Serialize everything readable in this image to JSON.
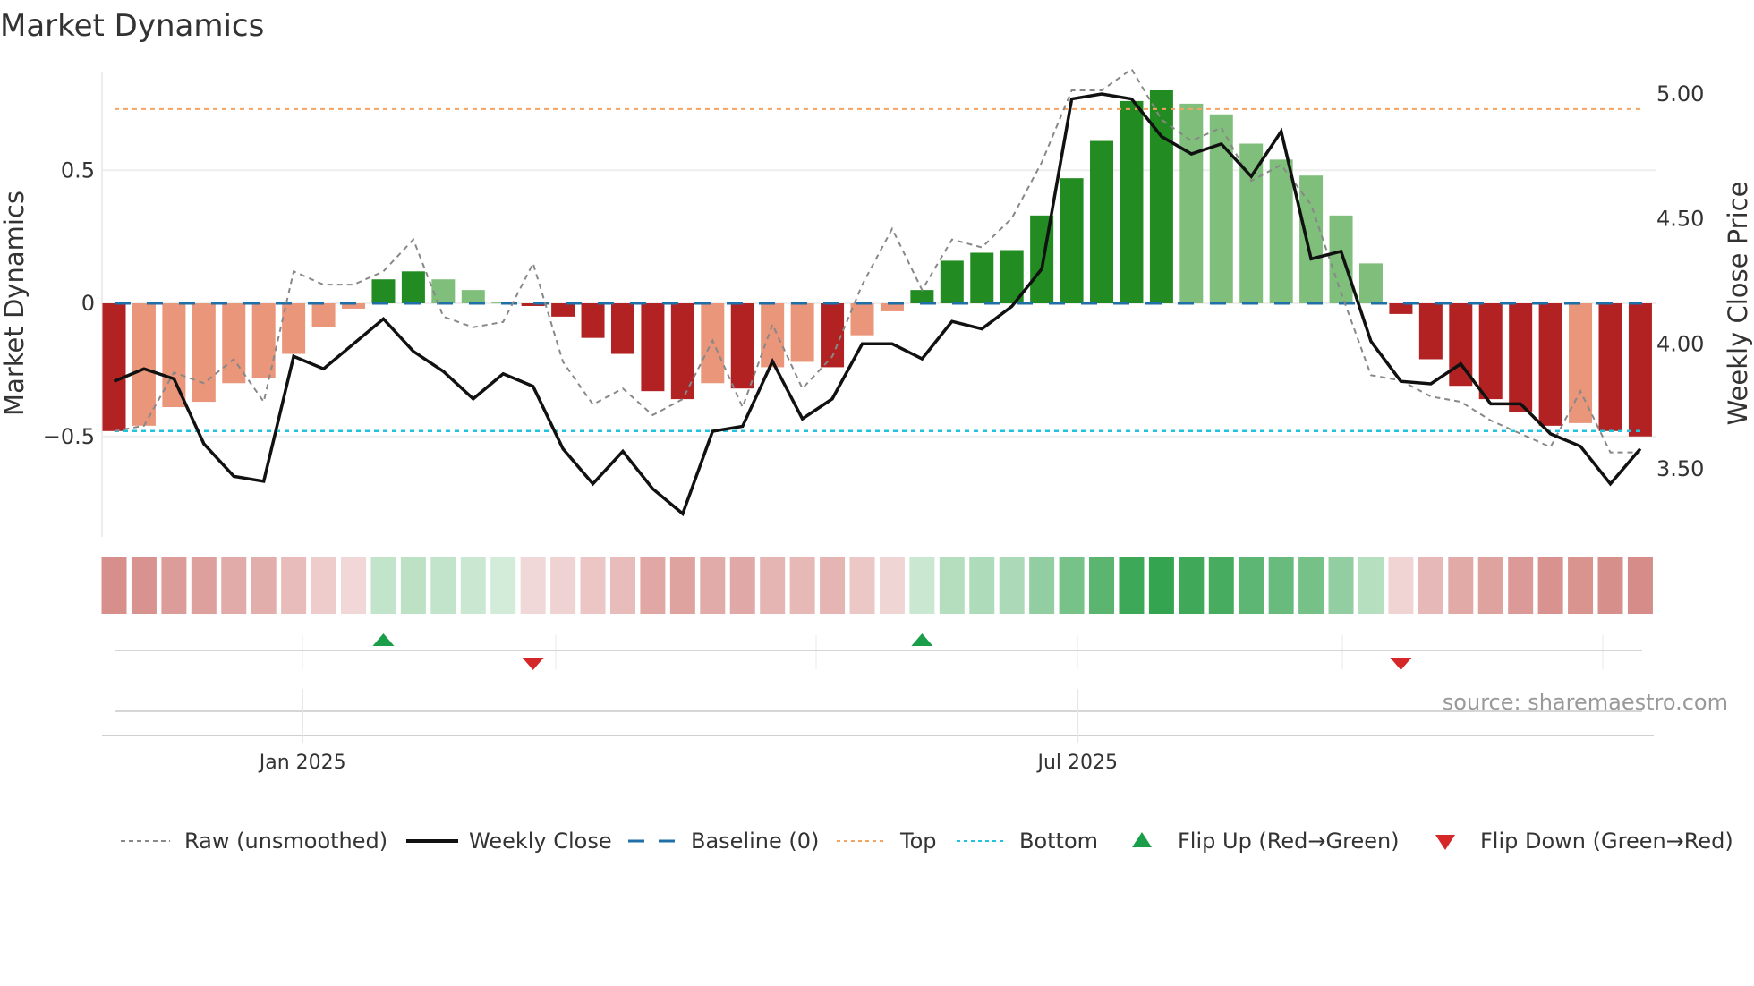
{
  "chart_data": {
    "type": "bar",
    "title": "Market Dynamics",
    "ylabel": "Market Dynamics",
    "y2label": "Weekly Close Price",
    "ylim": [
      -0.75,
      0.9
    ],
    "y2lim": [
      3.3,
      5.1
    ],
    "yticks": [
      {
        "v": 0.5,
        "label": "0.5"
      },
      {
        "v": 0,
        "label": "0"
      },
      {
        "v": -0.5,
        "label": "−0.5"
      }
    ],
    "y2ticks": [
      {
        "v": 5.0,
        "label": "5.00"
      },
      {
        "v": 4.5,
        "label": "4.50"
      },
      {
        "v": 4.0,
        "label": "4.00"
      },
      {
        "v": 3.5,
        "label": "3.50"
      }
    ],
    "xticks": [
      {
        "index": 6.3,
        "label": "Jan 2025"
      },
      {
        "index": 32.2,
        "label": "Jul 2025"
      }
    ],
    "frequency": "weekly",
    "values": [
      -0.48,
      -0.46,
      -0.39,
      -0.37,
      -0.3,
      -0.28,
      -0.19,
      -0.09,
      -0.02,
      0.09,
      0.12,
      0.09,
      0.05,
      0.003,
      -0.01,
      -0.05,
      -0.13,
      -0.19,
      -0.33,
      -0.36,
      -0.3,
      -0.32,
      -0.24,
      -0.22,
      -0.24,
      -0.12,
      -0.03,
      0.05,
      0.16,
      0.19,
      0.2,
      0.33,
      0.47,
      0.61,
      0.76,
      0.8,
      0.75,
      0.71,
      0.6,
      0.54,
      0.48,
      0.33,
      0.15,
      -0.04,
      -0.21,
      -0.31,
      -0.36,
      -0.41,
      -0.46,
      -0.45,
      -0.48,
      -0.5
    ],
    "strength": [
      "s",
      "w",
      "w",
      "w",
      "w",
      "w",
      "w",
      "w",
      "w",
      "s",
      "s",
      "w",
      "w",
      "w",
      "s",
      "s",
      "s",
      "s",
      "s",
      "s",
      "w",
      "s",
      "w",
      "w",
      "s",
      "w",
      "w",
      "s",
      "s",
      "s",
      "s",
      "s",
      "s",
      "s",
      "s",
      "s",
      "w",
      "w",
      "w",
      "w",
      "w",
      "w",
      "w",
      "s",
      "s",
      "s",
      "s",
      "s",
      "s",
      "w",
      "s",
      "s"
    ],
    "raw": [
      -0.48,
      -0.46,
      -0.26,
      -0.3,
      -0.21,
      -0.37,
      0.12,
      0.07,
      0.07,
      0.12,
      0.24,
      -0.05,
      -0.09,
      -0.07,
      0.15,
      -0.22,
      -0.38,
      -0.32,
      -0.42,
      -0.36,
      -0.14,
      -0.39,
      -0.08,
      -0.32,
      -0.2,
      0.07,
      0.28,
      0.05,
      0.24,
      0.21,
      0.32,
      0.53,
      0.8,
      0.8,
      0.88,
      0.69,
      0.61,
      0.66,
      0.46,
      0.52,
      0.37,
      0.04,
      -0.27,
      -0.29,
      -0.35,
      -0.37,
      -0.44,
      -0.49,
      -0.54,
      -0.33,
      -0.56,
      -0.56
    ],
    "weekly_close": [
      3.85,
      3.9,
      3.86,
      3.6,
      3.47,
      3.45,
      3.95,
      3.9,
      4.0,
      4.1,
      3.97,
      3.89,
      3.78,
      3.88,
      3.83,
      3.58,
      3.44,
      3.57,
      3.42,
      3.32,
      3.65,
      3.67,
      3.93,
      3.7,
      3.78,
      4.0,
      4.0,
      3.94,
      4.09,
      4.06,
      4.15,
      4.3,
      4.98,
      5.0,
      4.98,
      4.83,
      4.76,
      4.8,
      4.67,
      4.85,
      4.34,
      4.37,
      4.01,
      3.85,
      3.84,
      3.92,
      3.76,
      3.76,
      3.64,
      3.59,
      3.44,
      3.58
    ],
    "baseline": 0,
    "top": 0.73,
    "bottom": -0.48,
    "flip_up_indices": [
      9,
      27
    ],
    "flip_down_indices": [
      14,
      43
    ],
    "legend_position": "bottom",
    "colors": {
      "strong_pos": "#228b22",
      "weak_pos": "#7fbf7b",
      "strong_neg": "#b22222",
      "weak_neg": "#e9967a",
      "raw": "#888888",
      "close": "#111111",
      "baseline": "#1f6fa8",
      "top": "#f4a460",
      "bottom": "#22c3dd",
      "flip_up": "#1a9e4a",
      "flip_down": "#d62728"
    }
  },
  "legend": {
    "raw": "Raw (unsmoothed)",
    "close": "Weekly Close",
    "baseline": "Baseline (0)",
    "top": "Top",
    "bottom": "Bottom",
    "flip_up": "Flip Up (Red→Green)",
    "flip_down": "Flip Down (Green→Red)"
  },
  "source": "source: sharemaestro.com"
}
